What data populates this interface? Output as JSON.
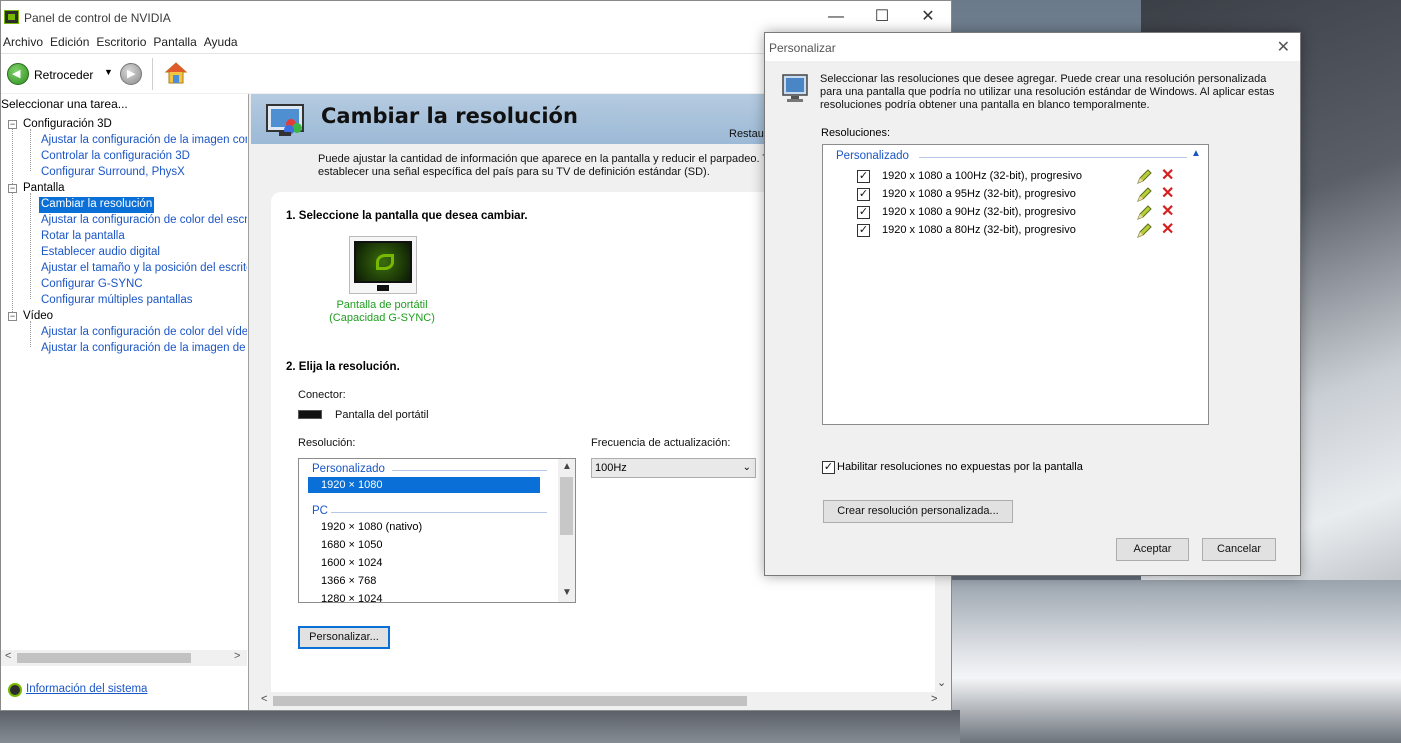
{
  "window": {
    "title": "Panel de control de NVIDIA"
  },
  "menu": [
    "Archivo",
    "Edición",
    "Escritorio",
    "Pantalla",
    "Ayuda"
  ],
  "toolbar": {
    "back_label": "Retroceder"
  },
  "tasks": {
    "header": "Seleccionar una tarea...",
    "categories": [
      {
        "label": "Configuración 3D",
        "items": [
          "Ajustar la configuración de la imagen con v",
          "Controlar la configuración 3D",
          "Configurar Surround, PhysX"
        ]
      },
      {
        "label": "Pantalla",
        "items": [
          "Cambiar la resolución",
          "Ajustar la configuración de color del escrito",
          "Rotar la pantalla",
          "Establecer audio digital",
          "Ajustar el tamaño y la posición del escritori",
          "Configurar G-SYNC",
          "Configurar múltiples pantallas"
        ]
      },
      {
        "label": "Vídeo",
        "items": [
          "Ajustar la configuración de color del vídeo",
          "Ajustar la configuración de la imagen de víd"
        ]
      }
    ],
    "selected": "Cambiar la resolución",
    "system_info": "Información del sistema"
  },
  "page": {
    "title": "Cambiar la resolución",
    "restore": "Restau",
    "intro_line1": "Puede ajustar la cantidad de información que aparece en la pantalla y reducir el parpadeo. Tam",
    "intro_line2": "establecer una señal específica del país para su TV de definición estándar (SD).",
    "step1": "1. Seleccione la pantalla que desea cambiar.",
    "display_name_line1": "Pantalla de portátil",
    "display_name_line2": "(Capacidad G-SYNC)",
    "step2": "2. Elija la resolución.",
    "connector_label": "Conector:",
    "connector_value": "Pantalla del portátil",
    "resolution_label": "Resolución:",
    "refresh_label": "Frecuencia de actualización:",
    "refresh_value": "100Hz",
    "resolution_groups": [
      {
        "label": "Personalizado",
        "items": [
          "1920 × 1080"
        ]
      },
      {
        "label": "PC",
        "items": [
          "1920 × 1080 (nativo)",
          "1680 × 1050",
          "1600 × 1024",
          "1366 × 768",
          "1280 × 1024"
        ]
      }
    ],
    "selected_resolution": "1920 × 1080",
    "customize_button": "Personalizar..."
  },
  "dialog": {
    "title": "Personalizar",
    "description": "Seleccionar las resoluciones que desee agregar. Puede crear una resolución personalizada para una pantalla que podría no utilizar una resolución estándar de Windows. Al aplicar estas resoluciones podría obtener una pantalla en blanco temporalmente.",
    "resolutions_label": "Resoluciones:",
    "group_label": "Personalizado",
    "rows": [
      {
        "text": "1920 x 1080 a 100Hz (32-bit), progresivo",
        "checked": true
      },
      {
        "text": "1920 x 1080 a 95Hz (32-bit), progresivo",
        "checked": true
      },
      {
        "text": "1920 x 1080 a 90Hz (32-bit), progresivo",
        "checked": true
      },
      {
        "text": "1920 x 1080 a 80Hz (32-bit), progresivo",
        "checked": true
      }
    ],
    "enable_label": "Habilitar resoluciones no expuestas por la pantalla",
    "enable_checked": true,
    "create_button": "Crear resolución personalizada...",
    "ok_button": "Aceptar",
    "cancel_button": "Cancelar"
  },
  "colors": {
    "nvidia_green": "#76b900",
    "link_blue": "#1b56c6",
    "selection": "#0a6fd6",
    "delete_red": "#d42020"
  }
}
